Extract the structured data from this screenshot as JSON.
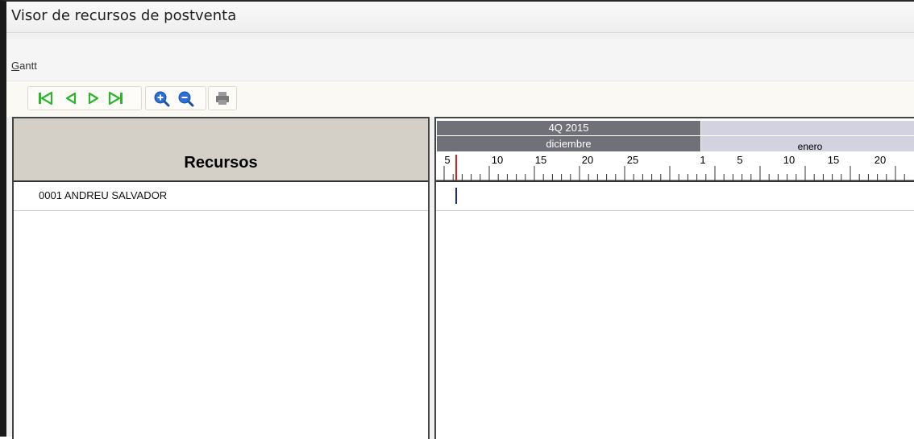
{
  "window": {
    "title": "Visor de recursos de postventa"
  },
  "menu": {
    "gantt_first": "G",
    "gantt_rest": "antt"
  },
  "toolbar": {
    "buttons": [
      "first-icon",
      "previous-icon",
      "next-icon",
      "last-icon",
      "zoom-in-icon",
      "zoom-out-icon",
      "print-icon"
    ],
    "accent_green": "#2db52d",
    "accent_blue": "#2a6fd6"
  },
  "resources": {
    "header": "Recursos",
    "rows": [
      "0001 ANDREU SALVADOR"
    ]
  },
  "gantt": {
    "quarter": "4Q 2015",
    "months": [
      "diciembre",
      "enero"
    ],
    "ticks": [
      "5",
      "10",
      "15",
      "20",
      "25",
      "1",
      "5",
      "10",
      "15",
      "20"
    ]
  }
}
